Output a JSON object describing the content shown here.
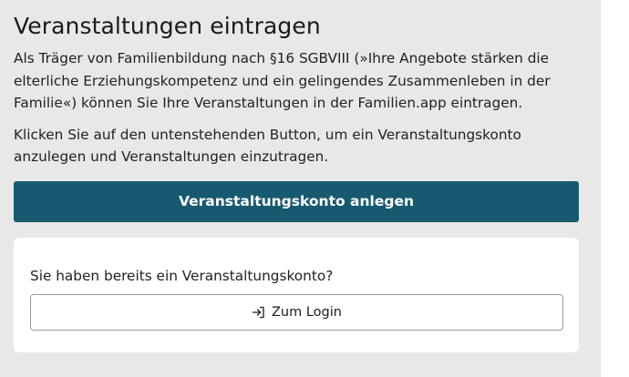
{
  "section": {
    "title": "Veranstaltungen eintragen",
    "paragraph_1": "Als Träger von Familienbildung nach §16 SGBVIII (»Ihre Angebote stärken die elterliche Erziehungskompetenz und ein gelingendes Zusammenleben in der Familie«) können Sie Ihre Veranstaltungen in der Familien.app eintragen.",
    "paragraph_2": "Klicken Sie auf den untenstehenden Button, um ein Veranstaltungskonto anzulegen und Veranstaltungen einzutragen.",
    "create_account_label": "Veranstaltungskonto anlegen"
  },
  "login_card": {
    "question": "Sie haben bereits ein Veranstaltungskonto?",
    "login_label": "Zum Login",
    "login_icon": "login-icon"
  },
  "colors": {
    "primary_button": "#175a70",
    "panel_background": "#e8e8e8",
    "card_background": "#ffffff"
  }
}
